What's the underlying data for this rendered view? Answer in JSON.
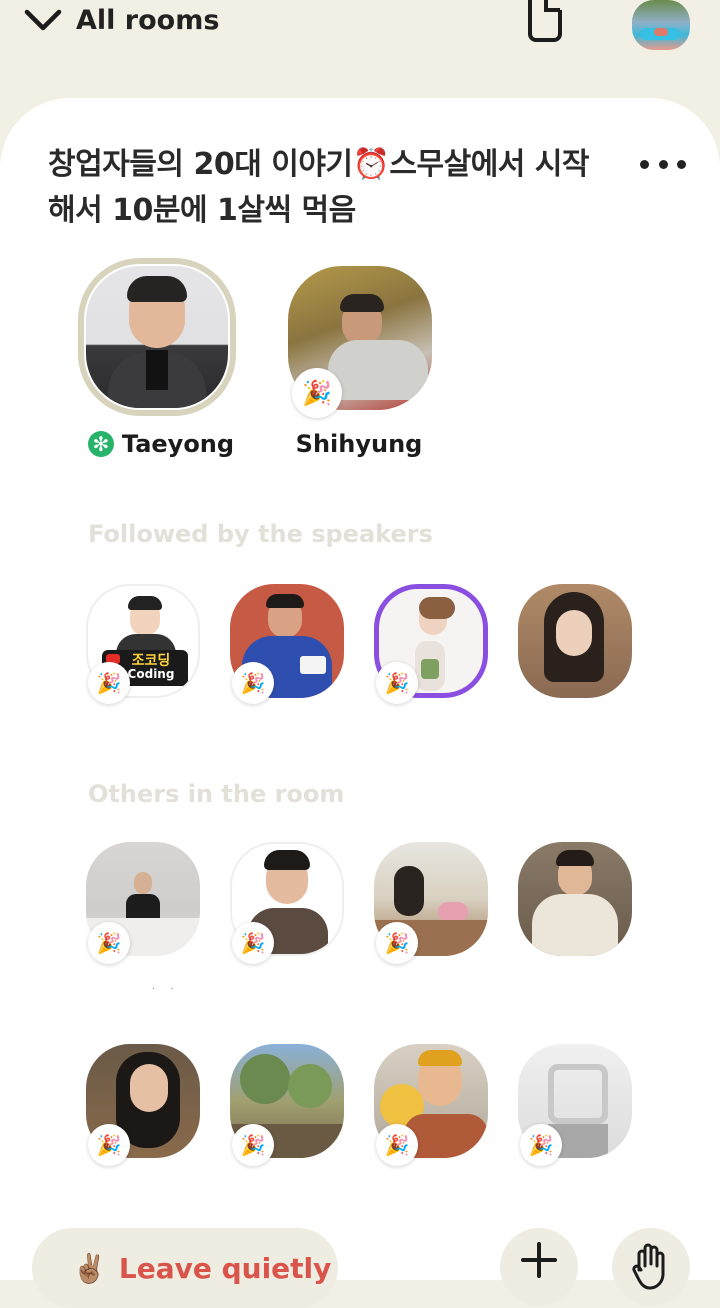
{
  "topbar": {
    "back_label": "All rooms",
    "back_icon": "chevron-down-icon",
    "doc_icon": "document-icon"
  },
  "room": {
    "title": "창업자들의 20대 이야기⏰스무살에서 시작해서 10분에 1살씩 먹음"
  },
  "speakers": [
    {
      "name": "Taeyong",
      "moderator": true,
      "speaking": true
    },
    {
      "name": "Shihyung",
      "moderator": false,
      "new_user_badge": "🎉"
    }
  ],
  "sections": {
    "followed_label": "Followed by the speakers",
    "others_label": "Others in the room"
  },
  "followed": [
    {
      "logo_top": "조코딩",
      "logo_bottom": "Coding",
      "new_user_badge": "🎉"
    },
    {
      "new_user_badge": "🎉"
    },
    {
      "new_user_badge": "🎉",
      "highlight": true
    },
    {
      "new_user_badge": ""
    }
  ],
  "others_row1": [
    {
      "new_user_badge": "🎉"
    },
    {
      "new_user_badge": "🎉"
    },
    {
      "new_user_badge": "🎉"
    },
    {
      "new_user_badge": "🎉"
    }
  ],
  "others_row2": [
    {
      "new_user_badge": "🎉"
    },
    {
      "new_user_badge": "🎉"
    },
    {
      "new_user_badge": "🎉"
    },
    {
      "new_user_badge": "🎉"
    }
  ],
  "bottom": {
    "leave_emoji": "✌🏽",
    "leave_label": "Leave quietly",
    "add_icon": "plus-icon",
    "raise_hand_icon": "raise-hand-icon"
  },
  "colors": {
    "background": "#f2f0e4",
    "sheet": "#ffffff",
    "leave_text": "#d9544a",
    "moderator_badge": "#27b36a",
    "speaking_ring": "#d8d3bc",
    "highlight_ring": "#8a4fe0"
  }
}
